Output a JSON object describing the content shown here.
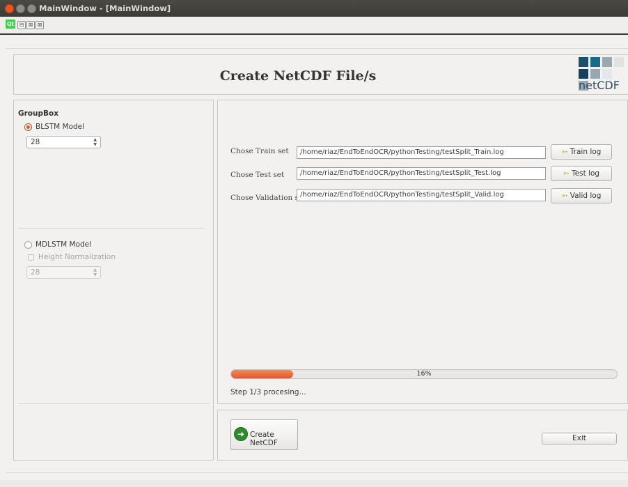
{
  "window": {
    "title": "MainWindow - [MainWindow]"
  },
  "mdi": {
    "logo": "Qt",
    "minimize": "⊟",
    "restore": "⊠",
    "close": "⊠"
  },
  "header": {
    "title": "Create NetCDF File/s",
    "logo_text": "netCDF"
  },
  "left_panel": {
    "group_title": "GroupBox",
    "blstm": {
      "label": "BLSTM Model",
      "checked": true,
      "spin_value": "28"
    },
    "mdlstm": {
      "label": "MDLSTM Model",
      "checked": false,
      "height_norm_label": "Height Normalization",
      "spin_value": "28"
    }
  },
  "files": {
    "train": {
      "label": "Chose Train set",
      "value": "/home/riaz/EndToEndOCR/pythonTesting/testSplit_Train.log",
      "button": "Train log"
    },
    "test": {
      "label": "Chose Test set",
      "value": "/home/riaz/EndToEndOCR/pythonTesting/testSplit_Test.log",
      "button": "Test log"
    },
    "valid": {
      "label": "Chose Validation set",
      "value": "/home/riaz/EndToEndOCR/pythonTesting/testSplit_Valid.log",
      "button": "Valid log"
    }
  },
  "progress": {
    "value": 0.16,
    "text": "16%",
    "status": "Step 1/3 procesing..."
  },
  "actions": {
    "create": "Create NetCDF",
    "exit": "Exit"
  },
  "colors": {
    "accent": "#e9653a",
    "titlebar": "#3c3b37",
    "close": "#e95420",
    "logo_dark": "#1d4f6e"
  }
}
